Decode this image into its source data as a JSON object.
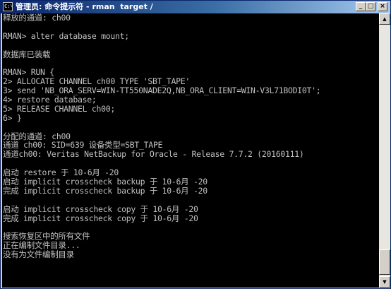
{
  "window": {
    "title": "管理员: 命令提示符 - rman  target /",
    "icon_name": "cmd-icon",
    "icon_glyph": "C:\\",
    "controls": {
      "minimize": "_",
      "maximize": "□",
      "close": "×"
    }
  },
  "console": {
    "lines": [
      "释放的通道: ch00",
      "",
      "RMAN> alter database mount;",
      "",
      "数据库已装载",
      "",
      "RMAN> RUN {",
      "2> ALLOCATE CHANNEL ch00 TYPE 'SBT_TAPE'",
      "3> send 'NB_ORA_SERV=WIN-TT550NADE2Q,NB_ORA_CLIENT=WIN-V3L71BODI0T';",
      "4> restore database;",
      "5> RELEASE CHANNEL ch00;",
      "6> }",
      "",
      "分配的通道: ch00",
      "通道 ch00: SID=639 设备类型=SBT_TAPE",
      "通道ch00: Veritas NetBackup for Oracle - Release 7.7.2 (20160111)",
      "",
      "启动 restore 于 10-6月 -20",
      "启动 implicit crosscheck backup 于 10-6月 -20",
      "完成 implicit crosscheck backup 于 10-6月 -20",
      "",
      "启动 implicit crosscheck copy 于 10-6月 -20",
      "完成 implicit crosscheck copy 于 10-6月 -20",
      "",
      "搜索恢复区中的所有文件",
      "正在编制文件目录...",
      "没有为文件编制目录"
    ]
  },
  "scrollbar": {
    "up_glyph": "▲",
    "down_glyph": "▼"
  },
  "colors": {
    "console_bg": "#000000",
    "console_fg": "#c0c0c0",
    "titlebar": "#0a246a"
  }
}
